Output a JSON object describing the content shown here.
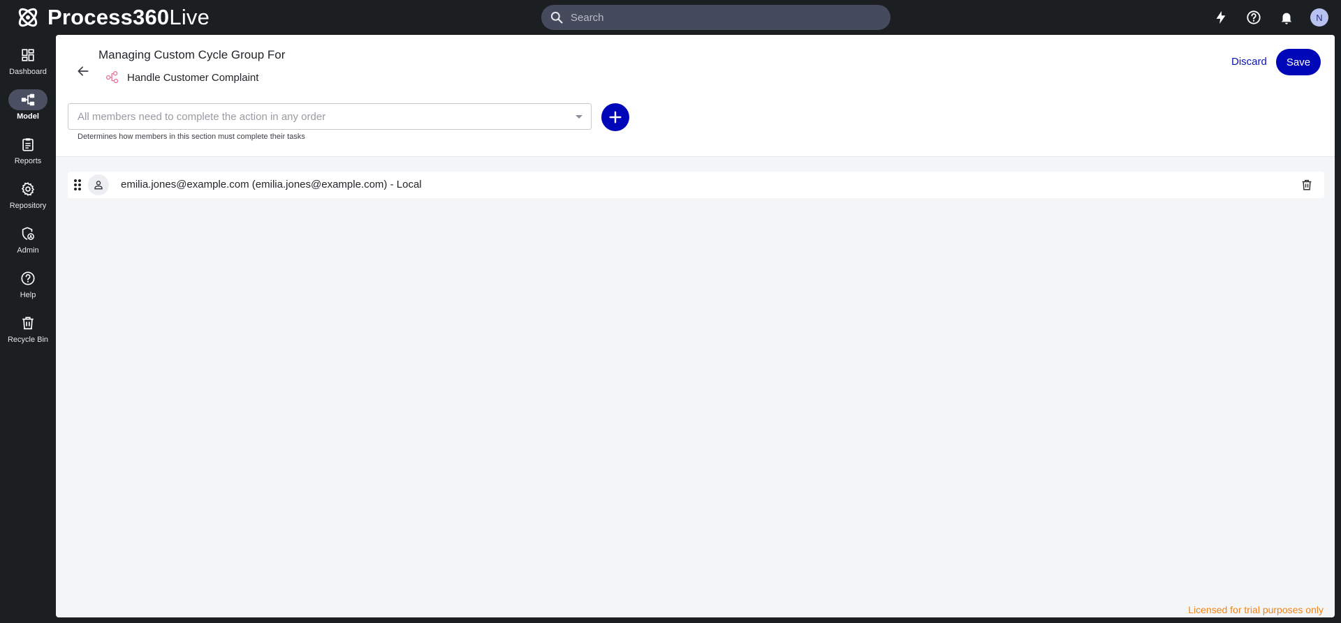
{
  "app": {
    "brand_bold": "Process360",
    "brand_light": "Live",
    "search_placeholder": "Search",
    "avatar_initial": "N"
  },
  "icons": {
    "top": [
      "bolt-icon",
      "help-circle-icon",
      "bell-icon"
    ],
    "colors": {
      "accent": "#0007b8",
      "process_icon": "#e8739a",
      "license": "#f08418"
    }
  },
  "sidebar": {
    "items": [
      {
        "label": "Dashboard",
        "icon": "dashboard-icon",
        "active": false
      },
      {
        "label": "Model",
        "icon": "model-icon",
        "active": true
      },
      {
        "label": "Reports",
        "icon": "clipboard-icon",
        "active": false
      },
      {
        "label": "Repository",
        "icon": "gear-icon",
        "active": false
      },
      {
        "label": "Admin",
        "icon": "admin-shield-icon",
        "active": false
      },
      {
        "label": "Help",
        "icon": "help-icon",
        "active": false
      },
      {
        "label": "Recycle Bin",
        "icon": "trash-icon",
        "active": false
      }
    ]
  },
  "page": {
    "title": "Managing Custom Cycle Group For",
    "process_name": "Handle Customer Complaint",
    "discard_label": "Discard",
    "save_label": "Save",
    "completion_mode": "All members need to complete the action in any order",
    "completion_helper": "Determines how members in this section must complete their tasks"
  },
  "members": [
    {
      "text": "emilia.jones@example.com (emilia.jones@example.com) - Local"
    }
  ],
  "footer": {
    "license": "Licensed for trial purposes only"
  }
}
